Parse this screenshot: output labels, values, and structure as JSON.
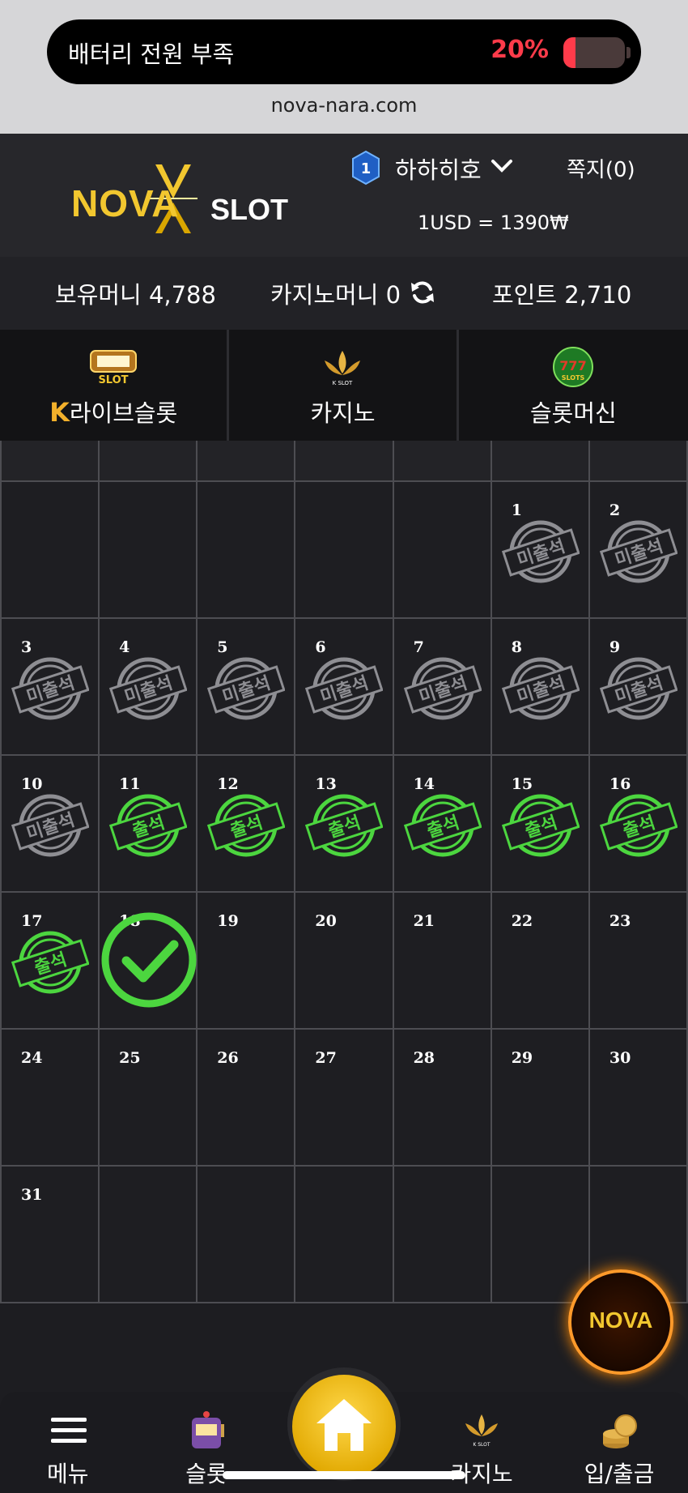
{
  "status": {
    "battery_message": "배터리 전원 부족",
    "battery_percent": "20%",
    "battery_level": 0.2,
    "url": "nova-nara.com"
  },
  "header": {
    "logo_nova": "NOVA",
    "logo_slot": "SLOT",
    "level": "1",
    "username": "하하히호",
    "messages": "쪽지(0)",
    "exchange_rate": "1USD = 1390₩"
  },
  "balance": {
    "money": "보유머니 4,788",
    "casino_money": "카지노머니 0",
    "points": "포인트 2,710"
  },
  "tabs": [
    {
      "label": "라이브슬롯",
      "icon": "live-slot-icon"
    },
    {
      "label": "카지노",
      "icon": "k-slot-lotus-icon"
    },
    {
      "label": "슬롯머신",
      "icon": "777-slots-icon"
    }
  ],
  "calendar": {
    "weeks": [
      [
        {
          "day": "",
          "status": ""
        },
        {
          "day": "",
          "status": ""
        },
        {
          "day": "",
          "status": ""
        },
        {
          "day": "",
          "status": ""
        },
        {
          "day": "",
          "status": ""
        },
        {
          "day": "1",
          "status": "미출석"
        },
        {
          "day": "2",
          "status": "미출석"
        }
      ],
      [
        {
          "day": "3",
          "status": "미출석"
        },
        {
          "day": "4",
          "status": "미출석"
        },
        {
          "day": "5",
          "status": "미출석"
        },
        {
          "day": "6",
          "status": "미출석"
        },
        {
          "day": "7",
          "status": "미출석"
        },
        {
          "day": "8",
          "status": "미출석"
        },
        {
          "day": "9",
          "status": "미출석"
        }
      ],
      [
        {
          "day": "10",
          "status": "미출석"
        },
        {
          "day": "11",
          "status": "출석"
        },
        {
          "day": "12",
          "status": "출석"
        },
        {
          "day": "13",
          "status": "출석"
        },
        {
          "day": "14",
          "status": "출석"
        },
        {
          "day": "15",
          "status": "출석"
        },
        {
          "day": "16",
          "status": "출석"
        }
      ],
      [
        {
          "day": "17",
          "status": "출석"
        },
        {
          "day": "18",
          "status": "today"
        },
        {
          "day": "19",
          "status": ""
        },
        {
          "day": "20",
          "status": ""
        },
        {
          "day": "21",
          "status": ""
        },
        {
          "day": "22",
          "status": ""
        },
        {
          "day": "23",
          "status": ""
        }
      ],
      [
        {
          "day": "24",
          "status": ""
        },
        {
          "day": "25",
          "status": ""
        },
        {
          "day": "26",
          "status": ""
        },
        {
          "day": "27",
          "status": ""
        },
        {
          "day": "28",
          "status": ""
        },
        {
          "day": "29",
          "status": ""
        },
        {
          "day": "30",
          "status": ""
        }
      ],
      [
        {
          "day": "31",
          "status": ""
        },
        {
          "day": "",
          "status": ""
        },
        {
          "day": "",
          "status": ""
        },
        {
          "day": "",
          "status": ""
        },
        {
          "day": "",
          "status": ""
        },
        {
          "day": "",
          "status": ""
        },
        {
          "day": "",
          "status": ""
        }
      ]
    ],
    "colors": {
      "attended": "#4cd63f",
      "absent": "#8e8e93"
    }
  },
  "fab": {
    "label": "NOVA"
  },
  "bottom_nav": [
    {
      "label": "메뉴",
      "icon": "hamburger-menu-icon"
    },
    {
      "label": "슬롯",
      "icon": "slot-machine-icon"
    },
    {
      "label": "",
      "icon": "home-icon"
    },
    {
      "label": "카지노",
      "icon": "k-slot-lotus-icon"
    },
    {
      "label": "입/출금",
      "icon": "coins-icon"
    }
  ]
}
